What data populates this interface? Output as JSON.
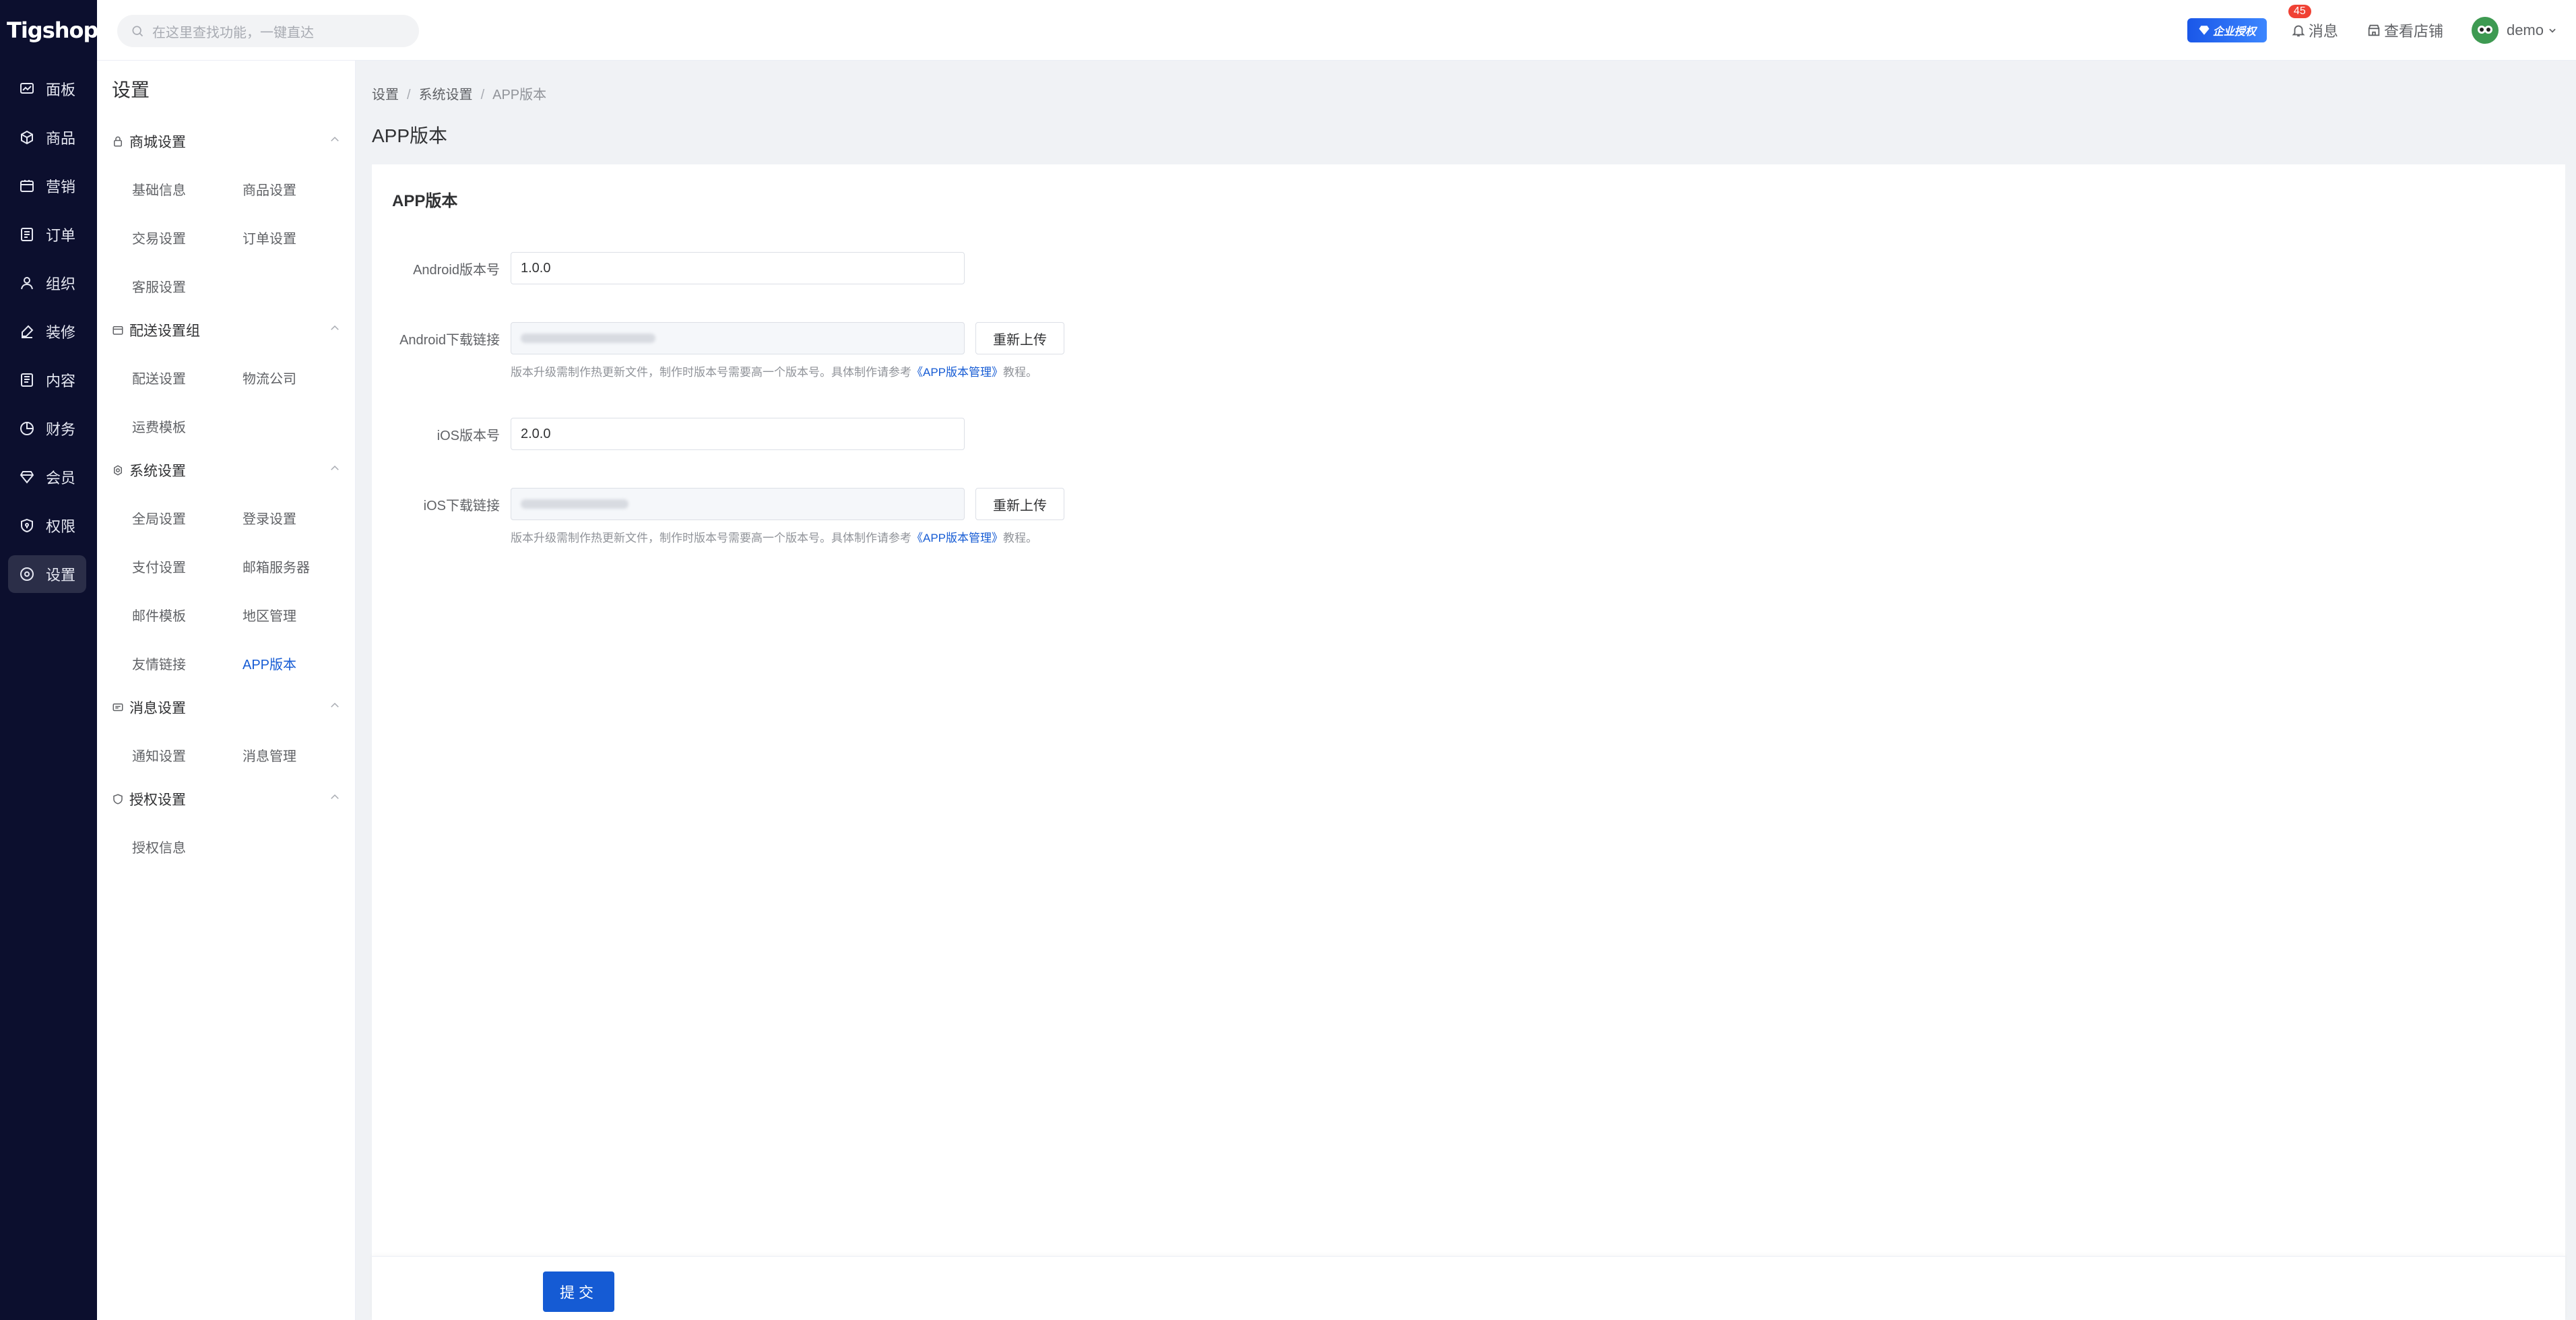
{
  "brand": {
    "logo_text": "Tigshop"
  },
  "nav": {
    "items": [
      {
        "label": "面板",
        "icon": "dashboard-icon"
      },
      {
        "label": "商品",
        "icon": "product-icon"
      },
      {
        "label": "营销",
        "icon": "marketing-icon"
      },
      {
        "label": "订单",
        "icon": "order-icon"
      },
      {
        "label": "组织",
        "icon": "organization-icon"
      },
      {
        "label": "装修",
        "icon": "decoration-icon"
      },
      {
        "label": "内容",
        "icon": "content-icon"
      },
      {
        "label": "财务",
        "icon": "finance-icon"
      },
      {
        "label": "会员",
        "icon": "member-icon"
      },
      {
        "label": "权限",
        "icon": "permission-icon"
      },
      {
        "label": "设置",
        "icon": "settings-icon",
        "active": true
      }
    ]
  },
  "topbar": {
    "search_placeholder": "在这里查找功能，一键直达",
    "enterprise_badge": "企业授权",
    "messages_label": "消息",
    "messages_count": "45",
    "view_store_label": "查看店铺",
    "user_name": "demo"
  },
  "submenu": {
    "title": "设置",
    "groups": [
      {
        "label": "商城设置",
        "items": [
          "基础信息",
          "商品设置",
          "交易设置",
          "订单设置",
          "客服设置"
        ]
      },
      {
        "label": "配送设置组",
        "items": [
          "配送设置",
          "物流公司",
          "运费模板"
        ]
      },
      {
        "label": "系统设置",
        "items": [
          "全局设置",
          "登录设置",
          "支付设置",
          "邮箱服务器",
          "邮件模板",
          "地区管理",
          "友情链接",
          "APP版本"
        ]
      },
      {
        "label": "消息设置",
        "items": [
          "通知设置",
          "消息管理"
        ]
      },
      {
        "label": "授权设置",
        "items": [
          "授权信息"
        ]
      }
    ],
    "active_item": "APP版本"
  },
  "breadcrumb": {
    "items": [
      "设置",
      "系统设置",
      "APP版本"
    ],
    "separator": "/"
  },
  "page": {
    "title": "APP版本",
    "card_title": "APP版本",
    "fields": {
      "android_version_label": "Android版本号",
      "android_version_value": "1.0.0",
      "android_link_label": "Android下载链接",
      "android_reupload": "重新上传",
      "ios_version_label": "iOS版本号",
      "ios_version_value": "2.0.0",
      "ios_link_label": "iOS下载链接",
      "ios_reupload": "重新上传"
    },
    "hint_prefix": "版本升级需制作热更新文件，制作时版本号需要高一个版本号。具体制作请参考",
    "hint_link": "《APP版本管理》",
    "hint_suffix": "教程。",
    "submit_label": "提交"
  },
  "colors": {
    "nav_bg": "#0c0f2e",
    "accent": "#155bd4",
    "badge_red": "#f04134"
  }
}
